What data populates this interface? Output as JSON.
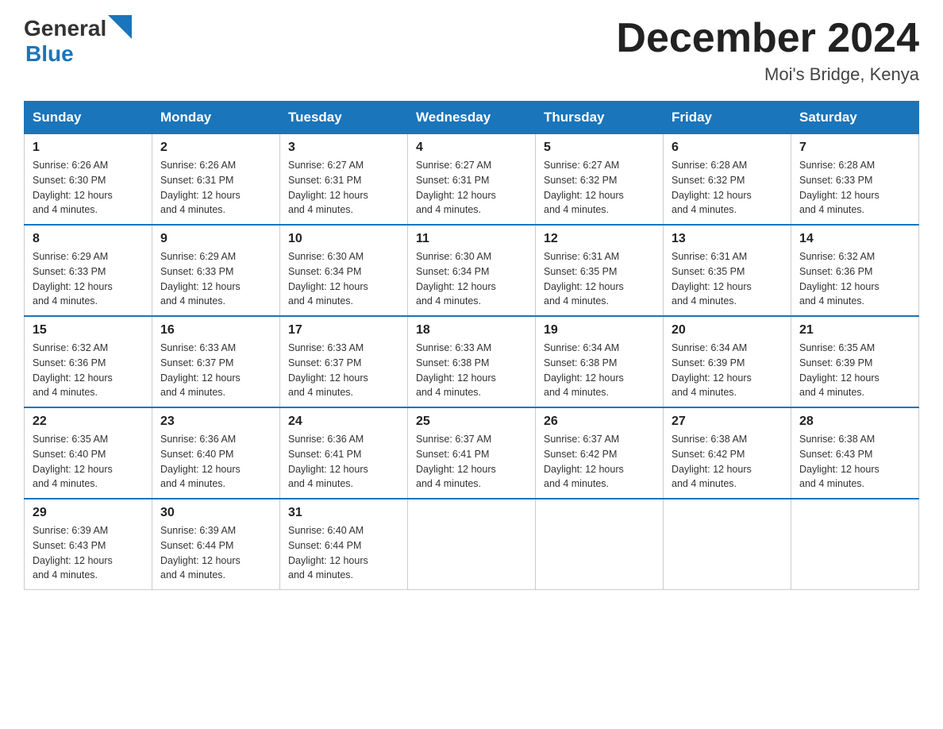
{
  "header": {
    "logo_general": "General",
    "logo_blue": "Blue",
    "month_title": "December 2024",
    "location": "Moi's Bridge, Kenya"
  },
  "weekdays": [
    "Sunday",
    "Monday",
    "Tuesday",
    "Wednesday",
    "Thursday",
    "Friday",
    "Saturday"
  ],
  "weeks": [
    [
      {
        "day": "1",
        "sunrise": "6:26 AM",
        "sunset": "6:30 PM",
        "daylight": "12 hours and 4 minutes."
      },
      {
        "day": "2",
        "sunrise": "6:26 AM",
        "sunset": "6:31 PM",
        "daylight": "12 hours and 4 minutes."
      },
      {
        "day": "3",
        "sunrise": "6:27 AM",
        "sunset": "6:31 PM",
        "daylight": "12 hours and 4 minutes."
      },
      {
        "day": "4",
        "sunrise": "6:27 AM",
        "sunset": "6:31 PM",
        "daylight": "12 hours and 4 minutes."
      },
      {
        "day": "5",
        "sunrise": "6:27 AM",
        "sunset": "6:32 PM",
        "daylight": "12 hours and 4 minutes."
      },
      {
        "day": "6",
        "sunrise": "6:28 AM",
        "sunset": "6:32 PM",
        "daylight": "12 hours and 4 minutes."
      },
      {
        "day": "7",
        "sunrise": "6:28 AM",
        "sunset": "6:33 PM",
        "daylight": "12 hours and 4 minutes."
      }
    ],
    [
      {
        "day": "8",
        "sunrise": "6:29 AM",
        "sunset": "6:33 PM",
        "daylight": "12 hours and 4 minutes."
      },
      {
        "day": "9",
        "sunrise": "6:29 AM",
        "sunset": "6:33 PM",
        "daylight": "12 hours and 4 minutes."
      },
      {
        "day": "10",
        "sunrise": "6:30 AM",
        "sunset": "6:34 PM",
        "daylight": "12 hours and 4 minutes."
      },
      {
        "day": "11",
        "sunrise": "6:30 AM",
        "sunset": "6:34 PM",
        "daylight": "12 hours and 4 minutes."
      },
      {
        "day": "12",
        "sunrise": "6:31 AM",
        "sunset": "6:35 PM",
        "daylight": "12 hours and 4 minutes."
      },
      {
        "day": "13",
        "sunrise": "6:31 AM",
        "sunset": "6:35 PM",
        "daylight": "12 hours and 4 minutes."
      },
      {
        "day": "14",
        "sunrise": "6:32 AM",
        "sunset": "6:36 PM",
        "daylight": "12 hours and 4 minutes."
      }
    ],
    [
      {
        "day": "15",
        "sunrise": "6:32 AM",
        "sunset": "6:36 PM",
        "daylight": "12 hours and 4 minutes."
      },
      {
        "day": "16",
        "sunrise": "6:33 AM",
        "sunset": "6:37 PM",
        "daylight": "12 hours and 4 minutes."
      },
      {
        "day": "17",
        "sunrise": "6:33 AM",
        "sunset": "6:37 PM",
        "daylight": "12 hours and 4 minutes."
      },
      {
        "day": "18",
        "sunrise": "6:33 AM",
        "sunset": "6:38 PM",
        "daylight": "12 hours and 4 minutes."
      },
      {
        "day": "19",
        "sunrise": "6:34 AM",
        "sunset": "6:38 PM",
        "daylight": "12 hours and 4 minutes."
      },
      {
        "day": "20",
        "sunrise": "6:34 AM",
        "sunset": "6:39 PM",
        "daylight": "12 hours and 4 minutes."
      },
      {
        "day": "21",
        "sunrise": "6:35 AM",
        "sunset": "6:39 PM",
        "daylight": "12 hours and 4 minutes."
      }
    ],
    [
      {
        "day": "22",
        "sunrise": "6:35 AM",
        "sunset": "6:40 PM",
        "daylight": "12 hours and 4 minutes."
      },
      {
        "day": "23",
        "sunrise": "6:36 AM",
        "sunset": "6:40 PM",
        "daylight": "12 hours and 4 minutes."
      },
      {
        "day": "24",
        "sunrise": "6:36 AM",
        "sunset": "6:41 PM",
        "daylight": "12 hours and 4 minutes."
      },
      {
        "day": "25",
        "sunrise": "6:37 AM",
        "sunset": "6:41 PM",
        "daylight": "12 hours and 4 minutes."
      },
      {
        "day": "26",
        "sunrise": "6:37 AM",
        "sunset": "6:42 PM",
        "daylight": "12 hours and 4 minutes."
      },
      {
        "day": "27",
        "sunrise": "6:38 AM",
        "sunset": "6:42 PM",
        "daylight": "12 hours and 4 minutes."
      },
      {
        "day": "28",
        "sunrise": "6:38 AM",
        "sunset": "6:43 PM",
        "daylight": "12 hours and 4 minutes."
      }
    ],
    [
      {
        "day": "29",
        "sunrise": "6:39 AM",
        "sunset": "6:43 PM",
        "daylight": "12 hours and 4 minutes."
      },
      {
        "day": "30",
        "sunrise": "6:39 AM",
        "sunset": "6:44 PM",
        "daylight": "12 hours and 4 minutes."
      },
      {
        "day": "31",
        "sunrise": "6:40 AM",
        "sunset": "6:44 PM",
        "daylight": "12 hours and 4 minutes."
      },
      null,
      null,
      null,
      null
    ]
  ],
  "labels": {
    "sunrise": "Sunrise:",
    "sunset": "Sunset:",
    "daylight": "Daylight:"
  }
}
